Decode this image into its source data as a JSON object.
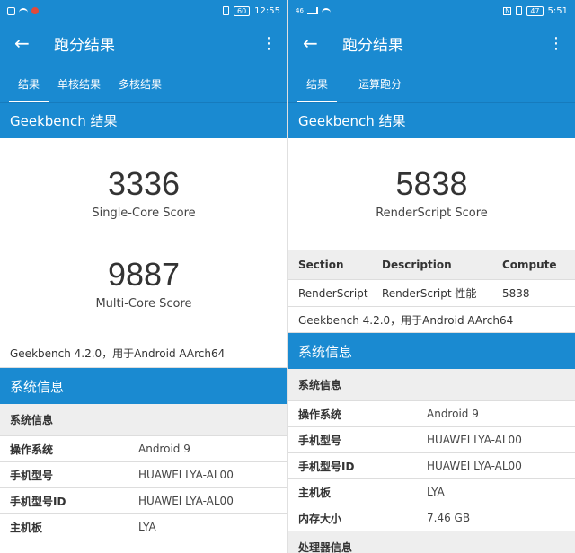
{
  "left": {
    "status": {
      "battery": "60",
      "time": "12:55"
    },
    "appbar": {
      "title": "跑分结果"
    },
    "tabs": [
      "结果",
      "单核结果",
      "多核结果"
    ],
    "section_title": "Geekbench 结果",
    "scores": [
      {
        "value": "3336",
        "label": "Single-Core Score"
      },
      {
        "value": "9887",
        "label": "Multi-Core Score"
      }
    ],
    "version_line": "Geekbench 4.2.0，用于Android AArch64",
    "system": {
      "title": "系统信息",
      "subtitle": "系统信息",
      "rows": [
        {
          "key": "操作系统",
          "value": "Android 9"
        },
        {
          "key": "手机型号",
          "value": "HUAWEI LYA-AL00"
        },
        {
          "key": "手机型号ID",
          "value": "HUAWEI LYA-AL00"
        },
        {
          "key": "主机板",
          "value": "LYA"
        }
      ]
    }
  },
  "right": {
    "status": {
      "signal": "46",
      "battery": "47",
      "time": "5:51"
    },
    "appbar": {
      "title": "跑分结果"
    },
    "tabs": [
      "结果",
      "运算跑分"
    ],
    "section_title": "Geekbench 结果",
    "score": {
      "value": "5838",
      "label": "RenderScript Score"
    },
    "table": {
      "headers": [
        "Section",
        "Description",
        "Compute"
      ],
      "row": [
        "RenderScript",
        "RenderScript 性能",
        "5838"
      ]
    },
    "version_line": "Geekbench 4.2.0，用于Android AArch64",
    "system": {
      "title": "系统信息",
      "subtitle": "系统信息",
      "rows": [
        {
          "key": "操作系统",
          "value": "Android 9"
        },
        {
          "key": "手机型号",
          "value": "HUAWEI LYA-AL00"
        },
        {
          "key": "手机型号ID",
          "value": "HUAWEI LYA-AL00"
        },
        {
          "key": "主机板",
          "value": "LYA"
        },
        {
          "key": "内存大小",
          "value": "7.46 GB"
        }
      ],
      "processor_title": "处理器信息"
    }
  },
  "icons": {
    "back": "back-arrow-icon",
    "menu": "more-vert-icon",
    "wifi": "wifi-icon",
    "battery": "battery-icon",
    "vibrate": "vibrate-icon",
    "nfc": "nfc-icon",
    "signal": "signal-icon",
    "sim": "sim-icon",
    "notification": "notification-icon"
  },
  "colors": {
    "primary": "#1a8ad1",
    "subheader": "#eeeeee"
  }
}
